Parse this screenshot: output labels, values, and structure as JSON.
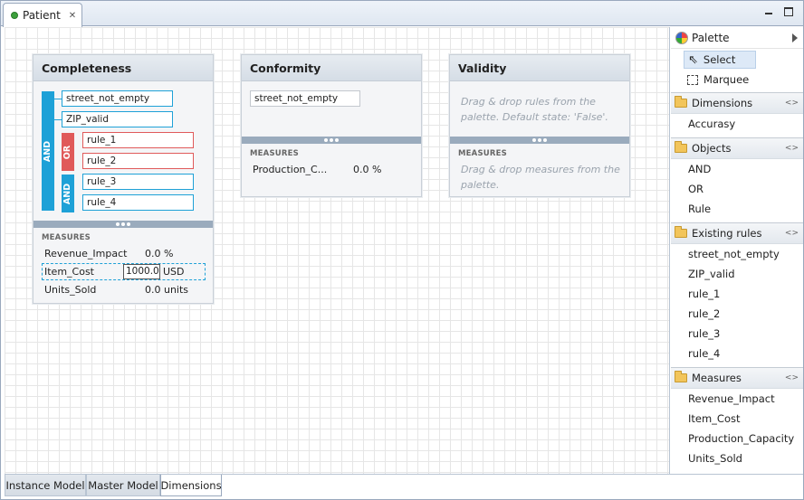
{
  "editor": {
    "tab_title": "Patient"
  },
  "cards": {
    "completeness": {
      "title": "Completeness",
      "and_label": "AND",
      "or_label": "OR",
      "and2_label": "AND",
      "rules": {
        "r1": "street_not_empty",
        "r2": "ZIP_valid",
        "r3": "rule_1",
        "r4": "rule_2",
        "r5": "rule_3",
        "r6": "rule_4"
      },
      "measures_header": "MEASURES",
      "measures": {
        "m1": {
          "name": "Revenue_Impact",
          "value": "0.0 %"
        },
        "m2": {
          "name": "Item_Cost",
          "input": "1000.0",
          "unit": "USD"
        },
        "m3": {
          "name": "Units_Sold",
          "value": "0.0 units"
        }
      }
    },
    "conformity": {
      "title": "Conformity",
      "rule": "street_not_empty",
      "measures_header": "MEASURES",
      "measure": {
        "name": "Production_C...",
        "value": "0.0 %"
      }
    },
    "validity": {
      "title": "Validity",
      "rules_hint": "Drag & drop rules from the palette. Default state: 'False'.",
      "measures_header": "MEASURES",
      "measures_hint": "Drag & drop measures from the palette."
    }
  },
  "palette": {
    "title": "Palette",
    "tools": {
      "select": "Select",
      "marquee": "Marquee"
    },
    "drawers": {
      "dimensions": {
        "label": "Dimensions",
        "items": [
          "Accurasy"
        ]
      },
      "objects": {
        "label": "Objects",
        "items": [
          "AND",
          "OR",
          "Rule"
        ]
      },
      "existing_rules": {
        "label": "Existing rules",
        "items": [
          "street_not_empty",
          "ZIP_valid",
          "rule_1",
          "rule_2",
          "rule_3",
          "rule_4"
        ]
      },
      "measures": {
        "label": "Measures",
        "items": [
          "Revenue_Impact",
          "Item_Cost",
          "Production_Capacity",
          "Units_Sold"
        ]
      }
    }
  },
  "bottom_tabs": {
    "t1": "Instance Model",
    "t2": "Master Model",
    "t3": "Dimensions"
  },
  "colors": {
    "and": "#1ea1d7",
    "or": "#e05a5a",
    "separator": "#9aabbd"
  }
}
